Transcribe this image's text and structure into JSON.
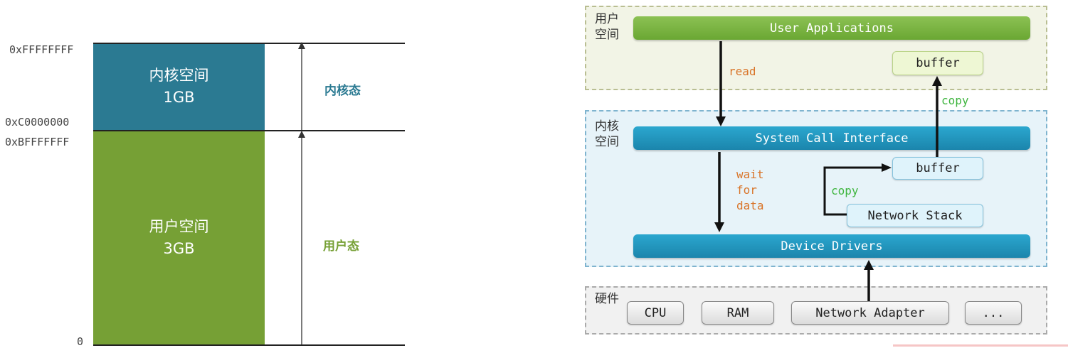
{
  "memory_map": {
    "addresses": {
      "top": "0xFFFFFFFF",
      "kernel_start": "0xC0000000",
      "user_end": "0xBFFFFFFF",
      "bottom": "0"
    },
    "kernel_block": {
      "name": "内核空间",
      "size": "1GB"
    },
    "user_block": {
      "name": "用户空间",
      "size": "3GB"
    },
    "kernel_state_label": "内核态",
    "user_state_label": "用户态"
  },
  "io_diagram": {
    "zones": {
      "user_space_label": "用户\n空间",
      "kernel_space_label": "内核\n空间",
      "hardware_label": "硬件"
    },
    "bars": {
      "user_applications": "User Applications",
      "system_call_interface": "System Call Interface",
      "device_drivers": "Device Drivers"
    },
    "boxes": {
      "user_buffer": "buffer",
      "kernel_buffer": "buffer",
      "network_stack": "Network Stack"
    },
    "hardware": [
      "CPU",
      "RAM",
      "Network Adapter",
      "..."
    ],
    "flow_labels": {
      "read": "read",
      "wait_for_data": "wait\nfor\ndata",
      "copy_to_user": "copy",
      "copy_to_kernel_buffer": "copy"
    }
  },
  "colors": {
    "kernel_block": "#2b7a92",
    "user_block": "#76a035",
    "orange_text": "#d9752a",
    "green_text": "#3fb53f"
  }
}
